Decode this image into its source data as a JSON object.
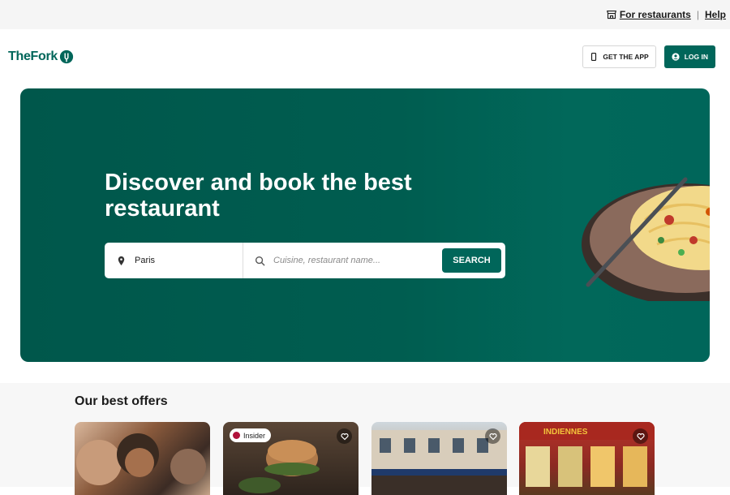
{
  "topbar": {
    "for_restaurants": "For restaurants",
    "help": "Help",
    "separator": "|"
  },
  "header": {
    "logo_text": "TheFork",
    "get_app": "GET THE APP",
    "login": "LOG IN"
  },
  "hero": {
    "title": "Discover and book the best restaurant",
    "location_value": "Paris",
    "query_placeholder": "Cuisine, restaurant name...",
    "search_button": "SEARCH"
  },
  "offers": {
    "title": "Our best offers",
    "cards": [
      {
        "badge": ""
      },
      {
        "badge": "Insider"
      },
      {
        "badge": ""
      },
      {
        "badge": ""
      }
    ]
  },
  "colors": {
    "brand": "#00665a",
    "insider_badge": "#b1123b"
  }
}
